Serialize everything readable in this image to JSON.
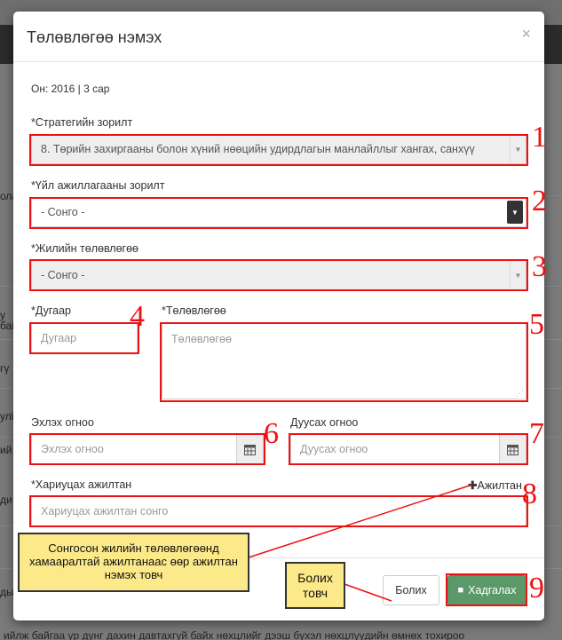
{
  "modal": {
    "title": "Төлөвлөгөө нэмэх",
    "close_glyph": "×",
    "info": "Он: 2016 | 3 сар"
  },
  "fields": {
    "strategy": {
      "label": "*Стратегийн зорилт",
      "value": "8. Төрийн захиргааны болон хүний нөөцийн удирдлагын манлайллыг хангах, санхүү"
    },
    "activity": {
      "label": "*Үйл ажиллагааны зорилт",
      "value": "- Сонго -"
    },
    "annual_plan": {
      "label": "*Жилийн төлөвлөгөө",
      "value": "- Сонго -"
    },
    "number": {
      "label": "*Дугаар",
      "placeholder": "Дугаар"
    },
    "plan": {
      "label": "*Төлөвлөгөө",
      "placeholder": "Төлөвлөгөө"
    },
    "start_date": {
      "label": "Эхлэх огноо",
      "placeholder": "Эхлэх огноо"
    },
    "end_date": {
      "label": "Дуусах огноо",
      "placeholder": "Дуусах огноо"
    },
    "responsible": {
      "label": "*Хариуцах ажилтан",
      "placeholder": "Хариуцах ажилтан сонго",
      "add_link": "Ажилтан"
    }
  },
  "buttons": {
    "cancel": "Болих",
    "save": "Хадгалах"
  },
  "annotations": {
    "numbers": [
      "1",
      "2",
      "3",
      "4",
      "5",
      "6",
      "7",
      "8",
      "9"
    ],
    "callout_add_employee": "Сонгосон жилийн төлөвлөгөөнд хамааралтай ажилтанаас өөр ажилтан нэмэх товч",
    "callout_cancel": "Болих товч",
    "highlight_color": "#e11111",
    "callout_color": "#fce98a"
  },
  "background": {
    "fragments": [
      "ола",
      "у",
      "бай",
      "гү",
      "улі",
      "ий",
      "ди",
      "ды"
    ],
    "bottom_text": "ийлж байгаа үр дүнг дахин давтахгүй байх нөхцлийг дээш бүхэл нөхцлүүдийн өмнөх тохироо"
  }
}
